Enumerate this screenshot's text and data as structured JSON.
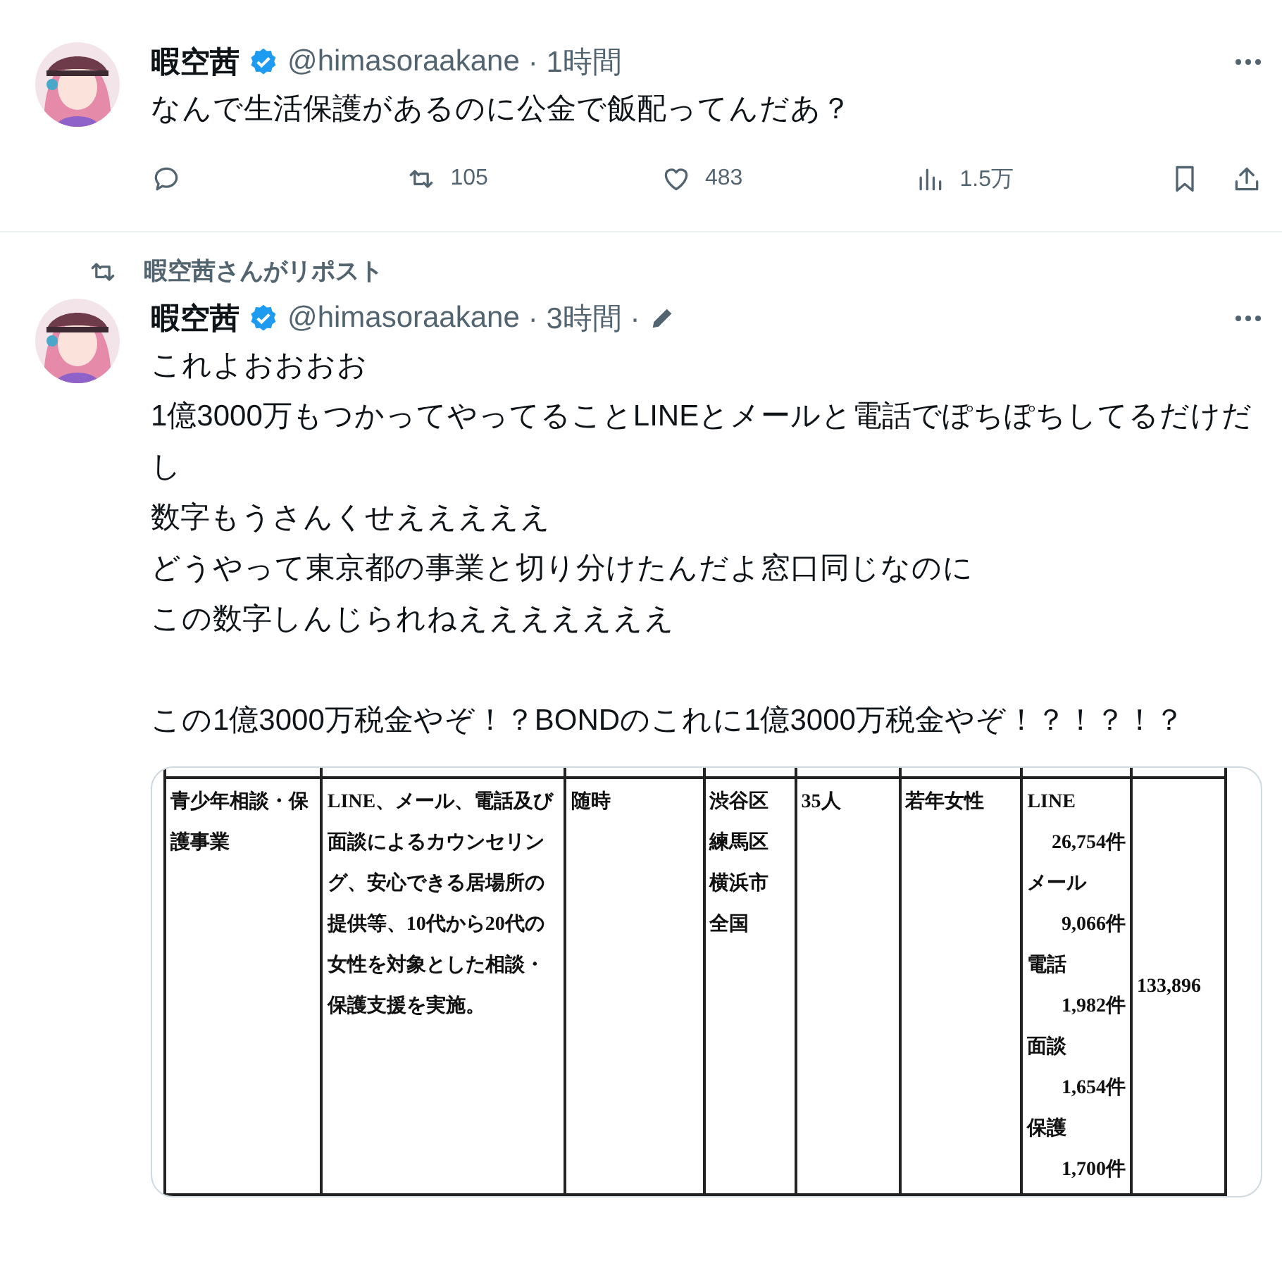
{
  "tweets": [
    {
      "author": {
        "name": "暇空茜",
        "handle": "@himasoraakane",
        "verified": true
      },
      "time": "· 1時間",
      "edited": false,
      "paragraphs": [
        [
          "なんで生活保護があるのに公金で飯配ってんだあ？"
        ]
      ],
      "actions": [
        {
          "kind": "reply"
        },
        {
          "kind": "repost",
          "count": "105"
        },
        {
          "kind": "like",
          "count": "483"
        },
        {
          "kind": "views",
          "count": "1.5万"
        },
        {
          "kind": "bookmark"
        },
        {
          "kind": "share"
        }
      ]
    },
    {
      "reposted_by": "暇空茜さんがリポスト",
      "author": {
        "name": "暇空茜",
        "handle": "@himasoraakane",
        "verified": true
      },
      "time": "· 3時間 ·",
      "edited": true,
      "paragraphs": [
        [
          "これよおおおお",
          "1億3000万もつかってやってることLINEとメールと電話でぽちぽちしてるだけだし",
          "数字もうさんくせえええええ",
          "どうやって東京都の事業と切り分けたんだよ窓口同じなのに",
          "この数字しんじられねえええええええ"
        ],
        [
          "この1億3000万税金やぞ！？BONDのこれに1億3000万税金やぞ！？！？！？"
        ]
      ],
      "document_table": {
        "cells": [
          {
            "kind": "text",
            "text": "青少年相談・保護事業"
          },
          {
            "kind": "text",
            "text": "LINE、メール、電話及び面談によるカウンセリング、安心できる居場所の提供等、10代から20代の女性を対象とした相談・保護支援を実施。"
          },
          {
            "kind": "text",
            "text": "随時"
          },
          {
            "kind": "lines",
            "lines": [
              "渋谷区",
              "練馬区",
              "横浜市",
              "全国"
            ]
          },
          {
            "kind": "text",
            "text": "35人"
          },
          {
            "kind": "text",
            "text": "若年女性"
          },
          {
            "kind": "counts",
            "items": [
              {
                "label": "LINE",
                "count": "26,754件"
              },
              {
                "label": "メール",
                "count": "9,066件"
              },
              {
                "label": "電話",
                "count": "1,982件"
              },
              {
                "label": "面談",
                "count": "1,654件"
              },
              {
                "label": "保護",
                "count": "1,700件"
              }
            ]
          },
          {
            "kind": "total",
            "text": "133,896"
          }
        ]
      }
    }
  ]
}
